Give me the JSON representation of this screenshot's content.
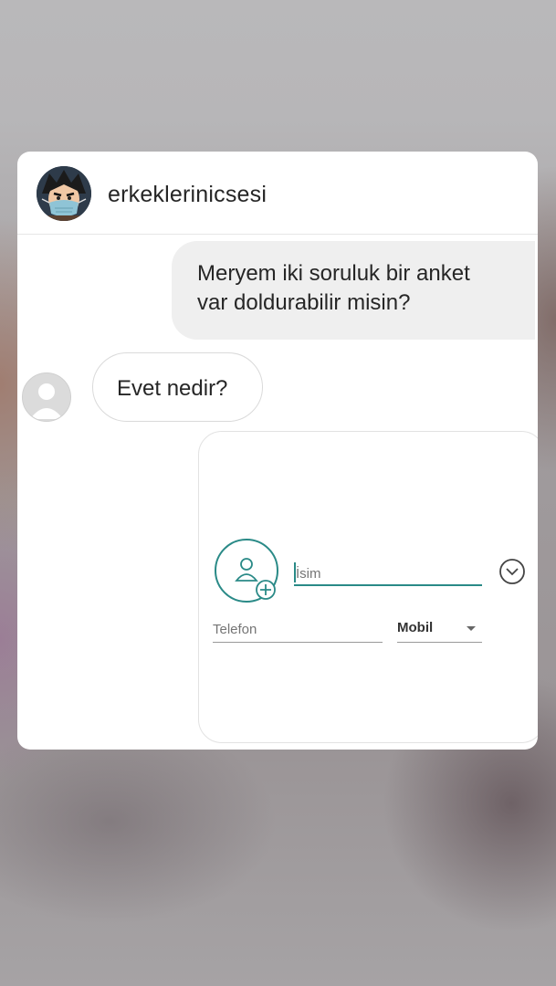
{
  "conversation": {
    "username": "erkeklerinicsesi",
    "messages": [
      {
        "direction": "outgoing",
        "lines": [
          "Meryem iki soruluk bir anket",
          "var doldurabilir misin?"
        ]
      },
      {
        "direction": "incoming",
        "text": "Evet nedir?"
      }
    ]
  },
  "shared_screenshot": {
    "name_placeholder": "İsim",
    "phone_placeholder": "Telefon",
    "phone_type": "Mobil",
    "icons": {
      "photo": "add-contact-photo-icon",
      "expand": "chevron-down-circle-icon",
      "dropdown": "caret-down-icon"
    }
  },
  "colors": {
    "accent": "#2a8a87",
    "outgoing_bubble": "#efefef",
    "text": "#262626"
  }
}
